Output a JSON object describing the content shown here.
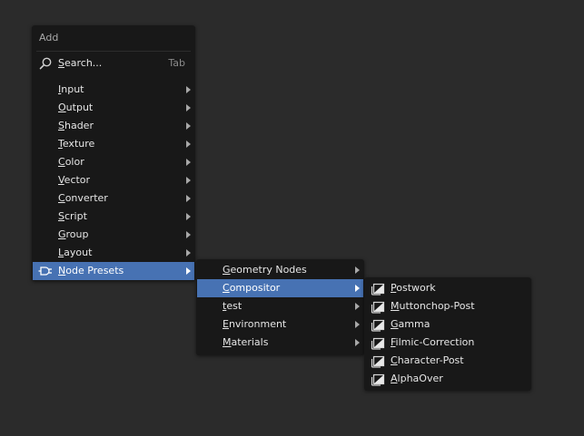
{
  "add_menu": {
    "title": "Add",
    "search": {
      "label": "Search...",
      "shortcut": "Tab",
      "icon": "search-icon"
    },
    "items": [
      {
        "label": "Input"
      },
      {
        "label": "Output"
      },
      {
        "label": "Shader"
      },
      {
        "label": "Texture"
      },
      {
        "label": "Color"
      },
      {
        "label": "Vector"
      },
      {
        "label": "Converter"
      },
      {
        "label": "Script"
      },
      {
        "label": "Group"
      },
      {
        "label": "Layout"
      },
      {
        "label": "Node Presets",
        "icon": "plugin-icon",
        "active": true
      }
    ]
  },
  "presets_menu": {
    "items": [
      {
        "label": "Geometry Nodes"
      },
      {
        "label": "Compositor",
        "active": true
      },
      {
        "label": "test"
      },
      {
        "label": "Environment"
      },
      {
        "label": "Materials"
      }
    ]
  },
  "compositor_menu": {
    "item_icon": "node-tree-icon",
    "items": [
      {
        "label": "Postwork"
      },
      {
        "label": "Muttonchop-Post"
      },
      {
        "label": "Gamma"
      },
      {
        "label": "Filmic-Correction"
      },
      {
        "label": "Character-Post"
      },
      {
        "label": "AlphaOver"
      }
    ]
  },
  "colors": {
    "background": "#2b2b2b",
    "menu_bg": "#181818",
    "highlight": "#4772b3",
    "text": "#e6e6e6",
    "dim_text": "#a8a8a8"
  }
}
